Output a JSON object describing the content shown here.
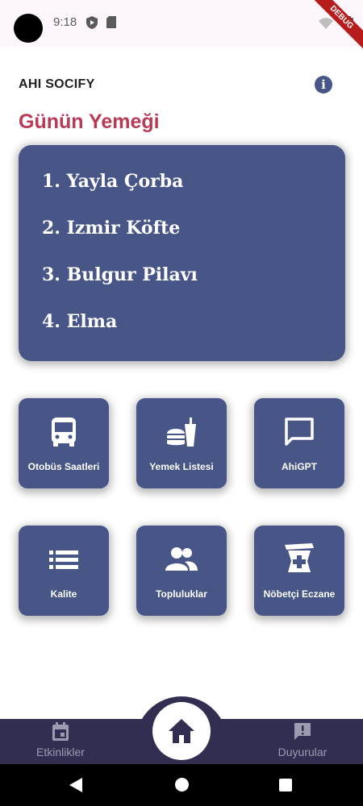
{
  "status_bar": {
    "time": "9:18",
    "debug_label": "DEBUG"
  },
  "app_bar": {
    "title": "AHI SOCIFY",
    "info_icon": "info-icon"
  },
  "daily_menu": {
    "title": "Günün Yemeği",
    "items": [
      "1. Yayla Çorba",
      "2. Izmir Köfte",
      "3. Bulgur Pilavı",
      "4. Elma"
    ]
  },
  "tiles": [
    {
      "label": "Otobüs Saatleri",
      "icon": "bus-icon"
    },
    {
      "label": "Yemek Listesi",
      "icon": "fastfood-icon"
    },
    {
      "label": "AhiGPT",
      "icon": "chat-icon"
    },
    {
      "label": "Kalite",
      "icon": "list-icon"
    },
    {
      "label": "Topluluklar",
      "icon": "people-icon"
    },
    {
      "label": "Nöbetçi Eczane",
      "icon": "pharmacy-icon"
    }
  ],
  "bottom_nav": {
    "left": {
      "label": "Etkinlikler",
      "icon": "calendar-icon"
    },
    "center": {
      "icon": "home-icon"
    },
    "right": {
      "label": "Duyurular",
      "icon": "announcement-icon"
    }
  },
  "colors": {
    "primary": "#475587",
    "accent": "#b83a55",
    "nav": "#312e52"
  }
}
